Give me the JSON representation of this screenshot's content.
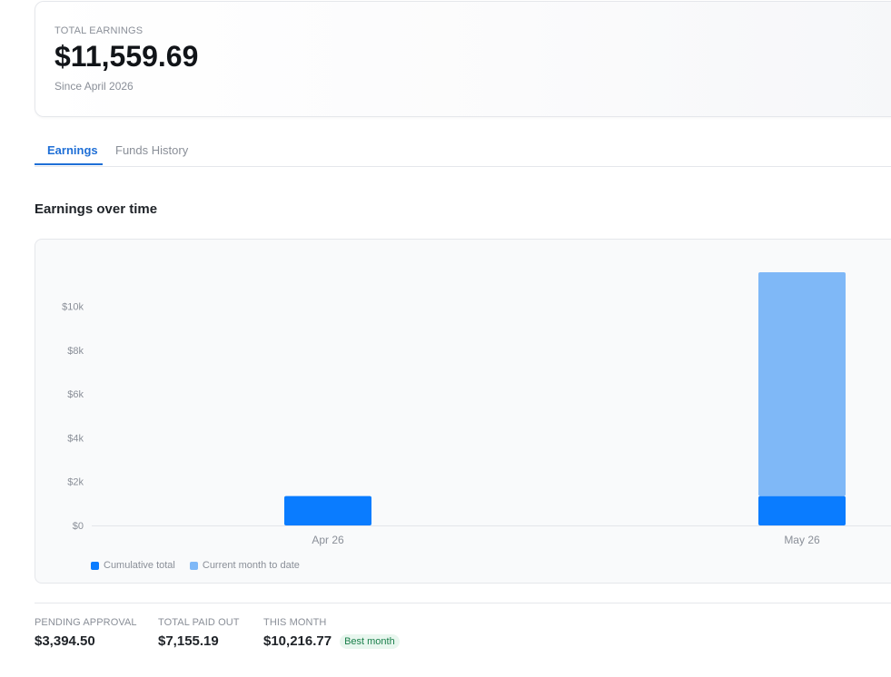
{
  "summary": {
    "label": "TOTAL EARNINGS",
    "amount": "$11,559.69",
    "since": "Since April 2026"
  },
  "tabs": [
    {
      "label": "Earnings",
      "active": true
    },
    {
      "label": "Funds History",
      "active": false
    }
  ],
  "section_title": "Earnings over time",
  "colors": {
    "accent": "#1f6fd6",
    "cumulative": "#0a7cff",
    "current_month": "#7fb8f7",
    "badge_text": "#1a7f4b",
    "badge_bg": "#e8f6ee"
  },
  "chart_data": {
    "type": "bar",
    "stacked": true,
    "categories": [
      "Apr 26",
      "May 26"
    ],
    "series": [
      {
        "name": "Cumulative total",
        "values": [
          1343,
          1343
        ]
      },
      {
        "name": "Current month to date",
        "values": [
          0,
          10217
        ]
      }
    ],
    "y_ticks": [
      0,
      2000,
      4000,
      6000,
      8000,
      10000
    ],
    "y_tick_labels": [
      "$0",
      "$2k",
      "$4k",
      "$6k",
      "$8k",
      "$10k"
    ],
    "ylim": [
      0,
      11560
    ],
    "grid": false,
    "legend_position": "bottom-left"
  },
  "stats": [
    {
      "label": "PENDING APPROVAL",
      "value": "$3,394.50"
    },
    {
      "label": "TOTAL PAID OUT",
      "value": "$7,155.19"
    },
    {
      "label": "THIS MONTH",
      "value": "$10,216.77",
      "badge": "Best month"
    }
  ]
}
